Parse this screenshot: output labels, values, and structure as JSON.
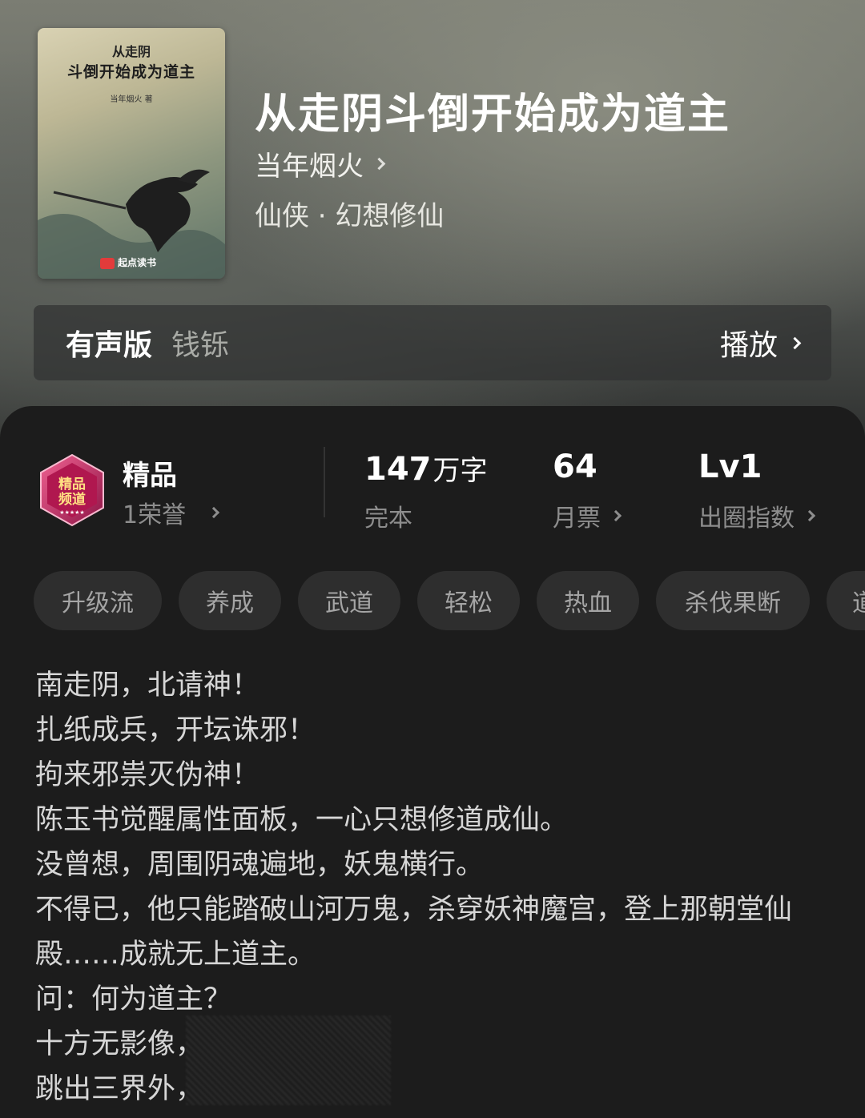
{
  "book": {
    "title": "从走阴斗倒开始成为道主",
    "author": "当年烟火",
    "genre": "仙侠 · 幻想修仙",
    "cover": {
      "title_line1": "从走阴",
      "title_line2": "斗倒开始成为道主",
      "author_line": "当年烟火 著",
      "publisher": "起点读书"
    }
  },
  "audio": {
    "label": "有声版",
    "narrator": "钱铄",
    "play_label": "播放"
  },
  "quality": {
    "badge_text": "精品频道",
    "title": "精品",
    "honor": "1荣誉"
  },
  "stats": [
    {
      "value": "147",
      "unit": "万字",
      "label": "完本"
    },
    {
      "value": "64",
      "unit": "",
      "label": "月票"
    },
    {
      "value": "Lv1",
      "unit": "",
      "label": "出圈指数"
    }
  ],
  "tags": [
    "升级流",
    "养成",
    "武道",
    "轻松",
    "热血",
    "杀伐果断",
    "道"
  ],
  "description": [
    "南走阴，北请神！",
    "扎纸成兵，开坛诛邪！",
    "拘来邪祟灭伪神！",
    "陈玉书觉醒属性面板，一心只想修道成仙。",
    "没曾想，周围阴魂遍地，妖鬼横行。",
    "不得已，他只能踏破山河万鬼，杀穿妖神魔宫，登上那朝堂仙殿……成就无上道主。",
    "问：何为道主？",
    "十方无影像，",
    "跳出三界外，"
  ],
  "colors": {
    "panel_bg": "#1c1c1c",
    "tag_bg": "#2e2e2e",
    "muted_text": "#8d8d8d",
    "badge_accent": "#c2185b"
  }
}
